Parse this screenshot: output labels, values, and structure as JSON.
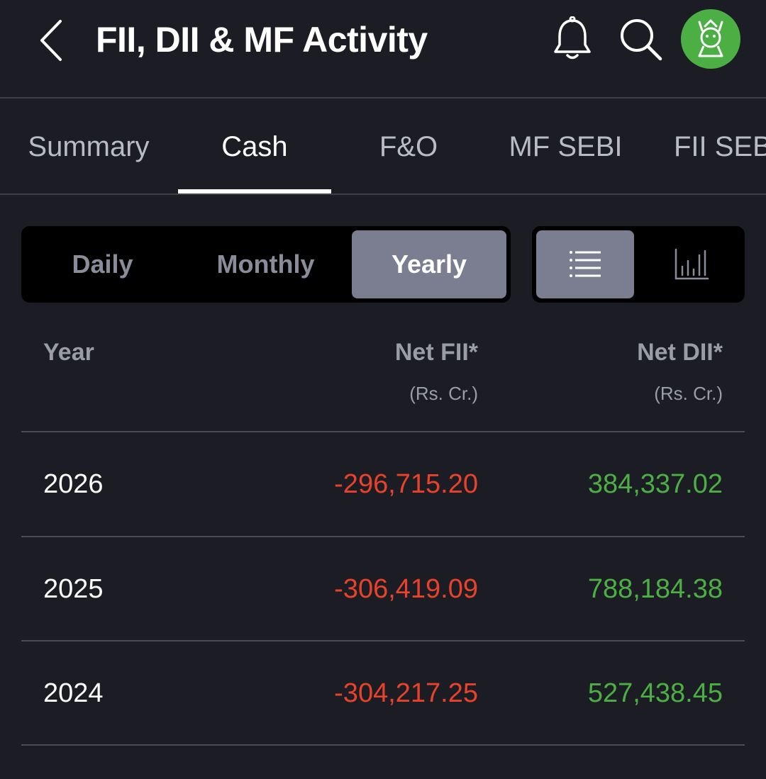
{
  "header": {
    "title": "FII, DII & MF Activity",
    "back_icon": "chevron-left-icon",
    "bell_icon": "bell-icon",
    "search_icon": "search-icon",
    "avatar_icon": "user-avatar-icon"
  },
  "tabs": [
    {
      "label": "Summary",
      "active": false
    },
    {
      "label": "Cash",
      "active": true
    },
    {
      "label": "F&O",
      "active": false
    },
    {
      "label": "MF SEBI",
      "active": false
    },
    {
      "label": "FII SEBI",
      "active": false
    }
  ],
  "period": {
    "options": [
      "Daily",
      "Monthly",
      "Yearly"
    ],
    "selected": "Yearly"
  },
  "view_toggle": {
    "options": [
      "list-icon",
      "bar-chart-icon"
    ],
    "selected": "list-icon"
  },
  "table": {
    "columns": [
      {
        "label": "Year",
        "sub": ""
      },
      {
        "label": "Net FII*",
        "sub": "(Rs. Cr.)"
      },
      {
        "label": "Net DII*",
        "sub": "(Rs. Cr.)"
      }
    ],
    "rows": [
      {
        "year": "2026",
        "fii": "-296,715.20",
        "dii": "384,337.02"
      },
      {
        "year": "2025",
        "fii": "-306,419.09",
        "dii": "788,184.38"
      },
      {
        "year": "2024",
        "fii": "-304,217.25",
        "dii": "527,438.45"
      }
    ]
  },
  "colors": {
    "background": "#1c1d24",
    "negative": "#e8432a",
    "positive": "#4caf44",
    "brand": "#4caf44",
    "active_segment": "#7b7e90"
  }
}
